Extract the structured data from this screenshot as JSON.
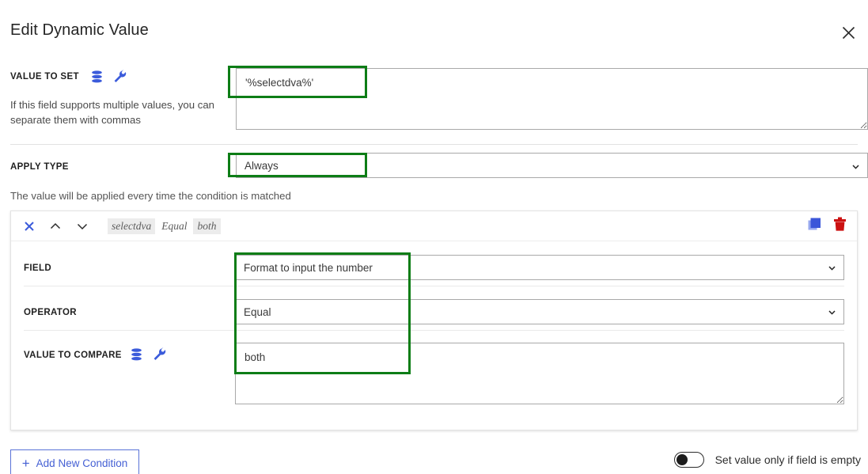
{
  "dialog": {
    "title": "Edit Dynamic Value",
    "close_icon": "close-icon"
  },
  "value_to_set": {
    "label": "VALUE TO SET",
    "database_icon": "database-icon",
    "wrench_icon": "wrench-icon",
    "helper": "If this field supports multiple values, you can separate them with commas",
    "value": "'%selectdva%'",
    "placeholder": ""
  },
  "apply_type": {
    "label": "APPLY TYPE",
    "value": "Always",
    "options": [
      "Always"
    ],
    "chevron_icon": "chevron-down-icon",
    "helper": "The value will be applied every time the condition is matched"
  },
  "condition": {
    "header": {
      "close_icon": "close-x-icon",
      "move_up_icon": "chevron-up-icon",
      "move_down_icon": "chevron-down-icon",
      "summary_field": "selectdva",
      "summary_operator": "Equal",
      "summary_value": "both",
      "duplicate_icon": "duplicate-icon",
      "delete_icon": "trash-icon"
    },
    "field": {
      "label": "FIELD",
      "value": "Format to input the number",
      "options": [
        "Format to input the number"
      ],
      "chevron_icon": "chevron-down-icon"
    },
    "operator": {
      "label": "OPERATOR",
      "value": "Equal",
      "options": [
        "Equal"
      ],
      "chevron_icon": "chevron-down-icon"
    },
    "value_to_compare": {
      "label": "VALUE TO COMPARE",
      "database_icon": "database-icon",
      "wrench_icon": "wrench-icon",
      "value": "both",
      "placeholder": ""
    }
  },
  "footer": {
    "add_condition_label": "Add New Condition",
    "add_icon": "plus-icon",
    "toggle_label": "Set value only if field is empty",
    "toggle_state": "off"
  },
  "colors": {
    "highlight": "#0d7d16",
    "accent_blue": "#4560d4",
    "icon_blue": "#3b5bdb",
    "delete_red": "#cc1111"
  }
}
